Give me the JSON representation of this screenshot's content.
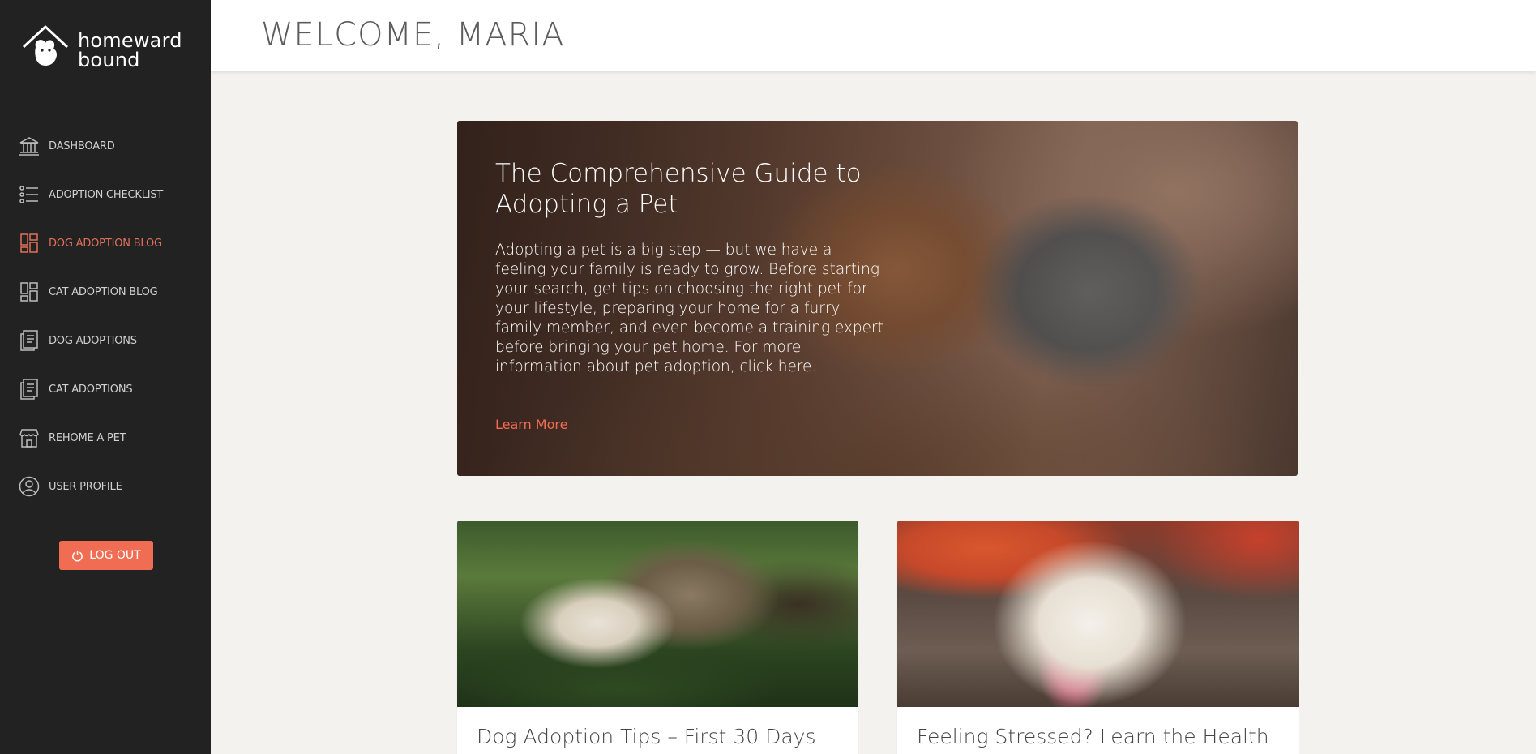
{
  "brand": {
    "line1": "homeward",
    "line2": "bound"
  },
  "sidebar": {
    "items": [
      {
        "label": "DASHBOARD",
        "icon": "bank-icon",
        "active": false
      },
      {
        "label": "ADOPTION CHECKLIST",
        "icon": "checklist-icon",
        "active": false
      },
      {
        "label": "DOG ADOPTION BLOG",
        "icon": "dashboard-grid-icon",
        "active": true
      },
      {
        "label": "CAT ADOPTION BLOG",
        "icon": "dashboard-grid-icon",
        "active": false
      },
      {
        "label": "DOG ADOPTIONS",
        "icon": "document-icon",
        "active": false
      },
      {
        "label": "CAT ADOPTIONS",
        "icon": "document-icon",
        "active": false
      },
      {
        "label": "REHOME A PET",
        "icon": "storefront-icon",
        "active": false
      },
      {
        "label": "USER PROFILE",
        "icon": "user-circle-icon",
        "active": false
      }
    ],
    "logout_label": "LOG OUT"
  },
  "header": {
    "title": "WELCOME, MARIA"
  },
  "hero": {
    "title": "The Comprehensive Guide to Adopting a Pet",
    "text": "Adopting a pet is a big step — but we have a feeling your family is ready to grow. Before starting your search, get tips on choosing the right pet for your lifestyle, preparing your home for a furry family member, and even become a training expert before bringing your pet home. For more information about pet adoption, click here.",
    "link_label": "Learn More"
  },
  "cards": [
    {
      "title": "Dog Adoption Tips – First 30 Days"
    },
    {
      "title": "Feeling Stressed? Learn the Health"
    }
  ],
  "colors": {
    "accent": "#f06d54",
    "sidebar_bg": "#222222",
    "page_bg": "#f3f2ef"
  }
}
